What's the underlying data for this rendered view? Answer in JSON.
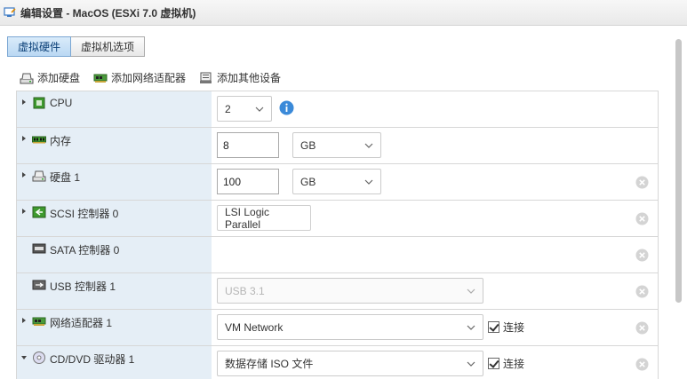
{
  "window": {
    "title": "编辑设置 - MacOS (ESXi 7.0 虚拟机)",
    "icon": "vm-edit-icon"
  },
  "tabs": [
    {
      "label": "虚拟硬件",
      "active": true
    },
    {
      "label": "虚拟机选项",
      "active": false
    }
  ],
  "toolbar": {
    "add_disk": "添加硬盘",
    "add_network_adapter": "添加网络适配器",
    "add_other_device": "添加其他设备"
  },
  "devices": {
    "cpu": {
      "label": "CPU",
      "value": "2",
      "icon": "cpu-icon"
    },
    "memory": {
      "label": "内存",
      "value": "8",
      "unit": "GB",
      "icon": "memory-icon"
    },
    "disk": {
      "label": "硬盘 1",
      "value": "100",
      "unit": "GB",
      "icon": "disk-icon"
    },
    "scsi": {
      "label": "SCSI 控制器 0",
      "value": "LSI Logic Parallel",
      "icon": "scsi-icon"
    },
    "sata": {
      "label": "SATA 控制器 0",
      "icon": "sata-icon"
    },
    "usb": {
      "label": "USB 控制器 1",
      "value": "USB 3.1",
      "icon": "usb-icon"
    },
    "network": {
      "label": "网络适配器 1",
      "value": "VM Network",
      "connect_label": "连接",
      "connected": true,
      "icon": "network-icon"
    },
    "cdrom": {
      "label": "CD/DVD 驱动器 1",
      "value": "数据存储 ISO 文件",
      "connect_label": "连接",
      "connected": true,
      "icon": "cd-icon"
    }
  },
  "colors": {
    "label_bg": "#e5eef6",
    "active_tab": "#bad8f3",
    "info_blue": "#3b8ad9"
  }
}
